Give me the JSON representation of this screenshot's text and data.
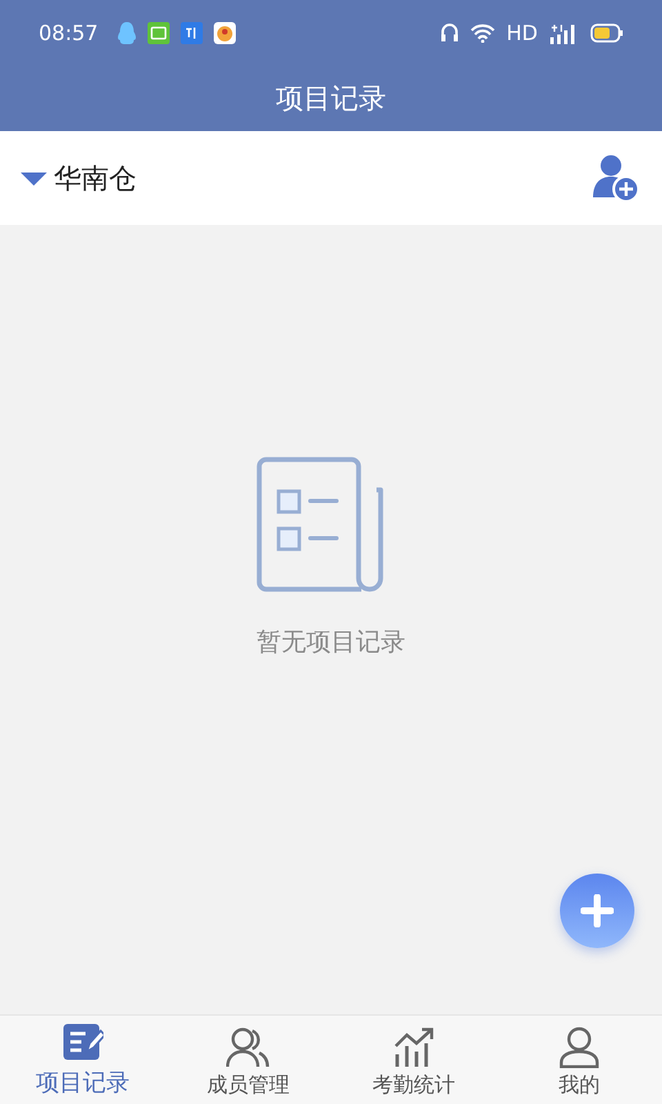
{
  "status_bar": {
    "time": "08:57",
    "network": "HD"
  },
  "header": {
    "title": "项目记录"
  },
  "warehouse": {
    "name": "华南仓",
    "expanded": true
  },
  "empty_state": {
    "message": "暂无项目记录"
  },
  "tabs": [
    {
      "label": "项目记录",
      "kind": "records",
      "selected": true
    },
    {
      "label": "成员管理",
      "kind": "members",
      "selected": false
    },
    {
      "label": "考勤统计",
      "kind": "stats",
      "selected": false
    },
    {
      "label": "我的",
      "kind": "profile",
      "selected": false
    }
  ]
}
